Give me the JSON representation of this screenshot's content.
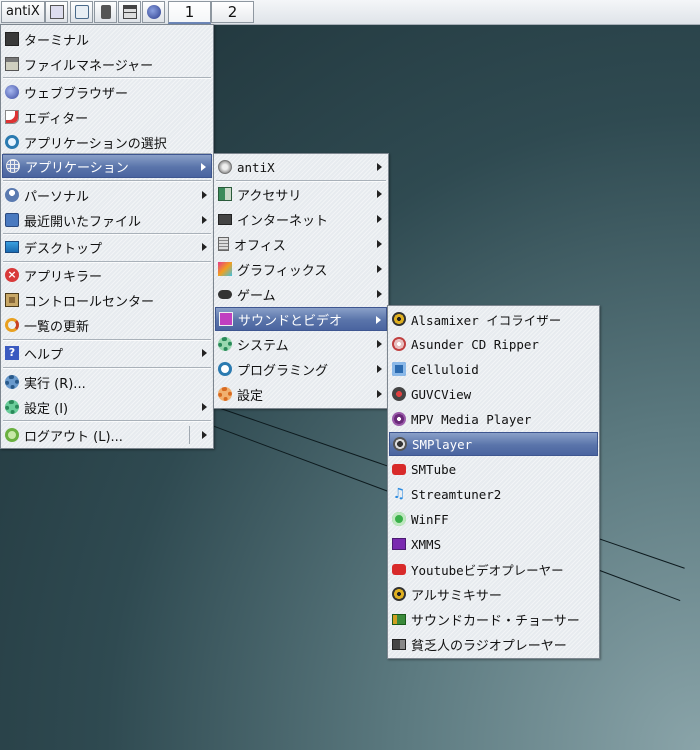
{
  "taskbar": {
    "start_label": "antiX",
    "workspaces": [
      "1",
      "2"
    ]
  },
  "main_menu": {
    "items": [
      {
        "label": "ターミナル"
      },
      {
        "label": "ファイルマネージャー"
      },
      {
        "label": "ウェブブラウザー"
      },
      {
        "label": "エディター"
      },
      {
        "label": "アプリケーションの選択"
      },
      {
        "label": "アプリケーション"
      },
      {
        "label": "パーソナル"
      },
      {
        "label": "最近開いたファイル"
      },
      {
        "label": "デスクトップ"
      },
      {
        "label": "アプリキラー"
      },
      {
        "label": "コントロールセンター"
      },
      {
        "label": "一覧の更新"
      },
      {
        "label": "ヘルプ"
      },
      {
        "label": "実行 (R)..."
      },
      {
        "label": "設定 (I)"
      },
      {
        "label": "ログアウト (L)..."
      }
    ]
  },
  "apps_menu": {
    "items": [
      {
        "label": "antiX"
      },
      {
        "label": "アクセサリ"
      },
      {
        "label": "インターネット"
      },
      {
        "label": "オフィス"
      },
      {
        "label": "グラフィックス"
      },
      {
        "label": "ゲーム"
      },
      {
        "label": "サウンドとビデオ"
      },
      {
        "label": "システム"
      },
      {
        "label": "プログラミング"
      },
      {
        "label": "設定"
      }
    ]
  },
  "av_menu": {
    "items": [
      {
        "label": "Alsamixer イコライザー"
      },
      {
        "label": "Asunder CD Ripper"
      },
      {
        "label": "Celluloid"
      },
      {
        "label": "GUVCView"
      },
      {
        "label": "MPV Media Player"
      },
      {
        "label": "SMPlayer"
      },
      {
        "label": "SMTube"
      },
      {
        "label": "Streamtuner2"
      },
      {
        "label": "WinFF"
      },
      {
        "label": "XMMS"
      },
      {
        "label": "Youtubeビデオプレーヤー"
      },
      {
        "label": "アルサミキサー"
      },
      {
        "label": "サウンドカード・チョーサー"
      },
      {
        "label": "貧乏人のラジオプレーヤー"
      }
    ]
  },
  "colors": {
    "selection": "#5a74aa",
    "menu_bg": "#e7ebef"
  }
}
